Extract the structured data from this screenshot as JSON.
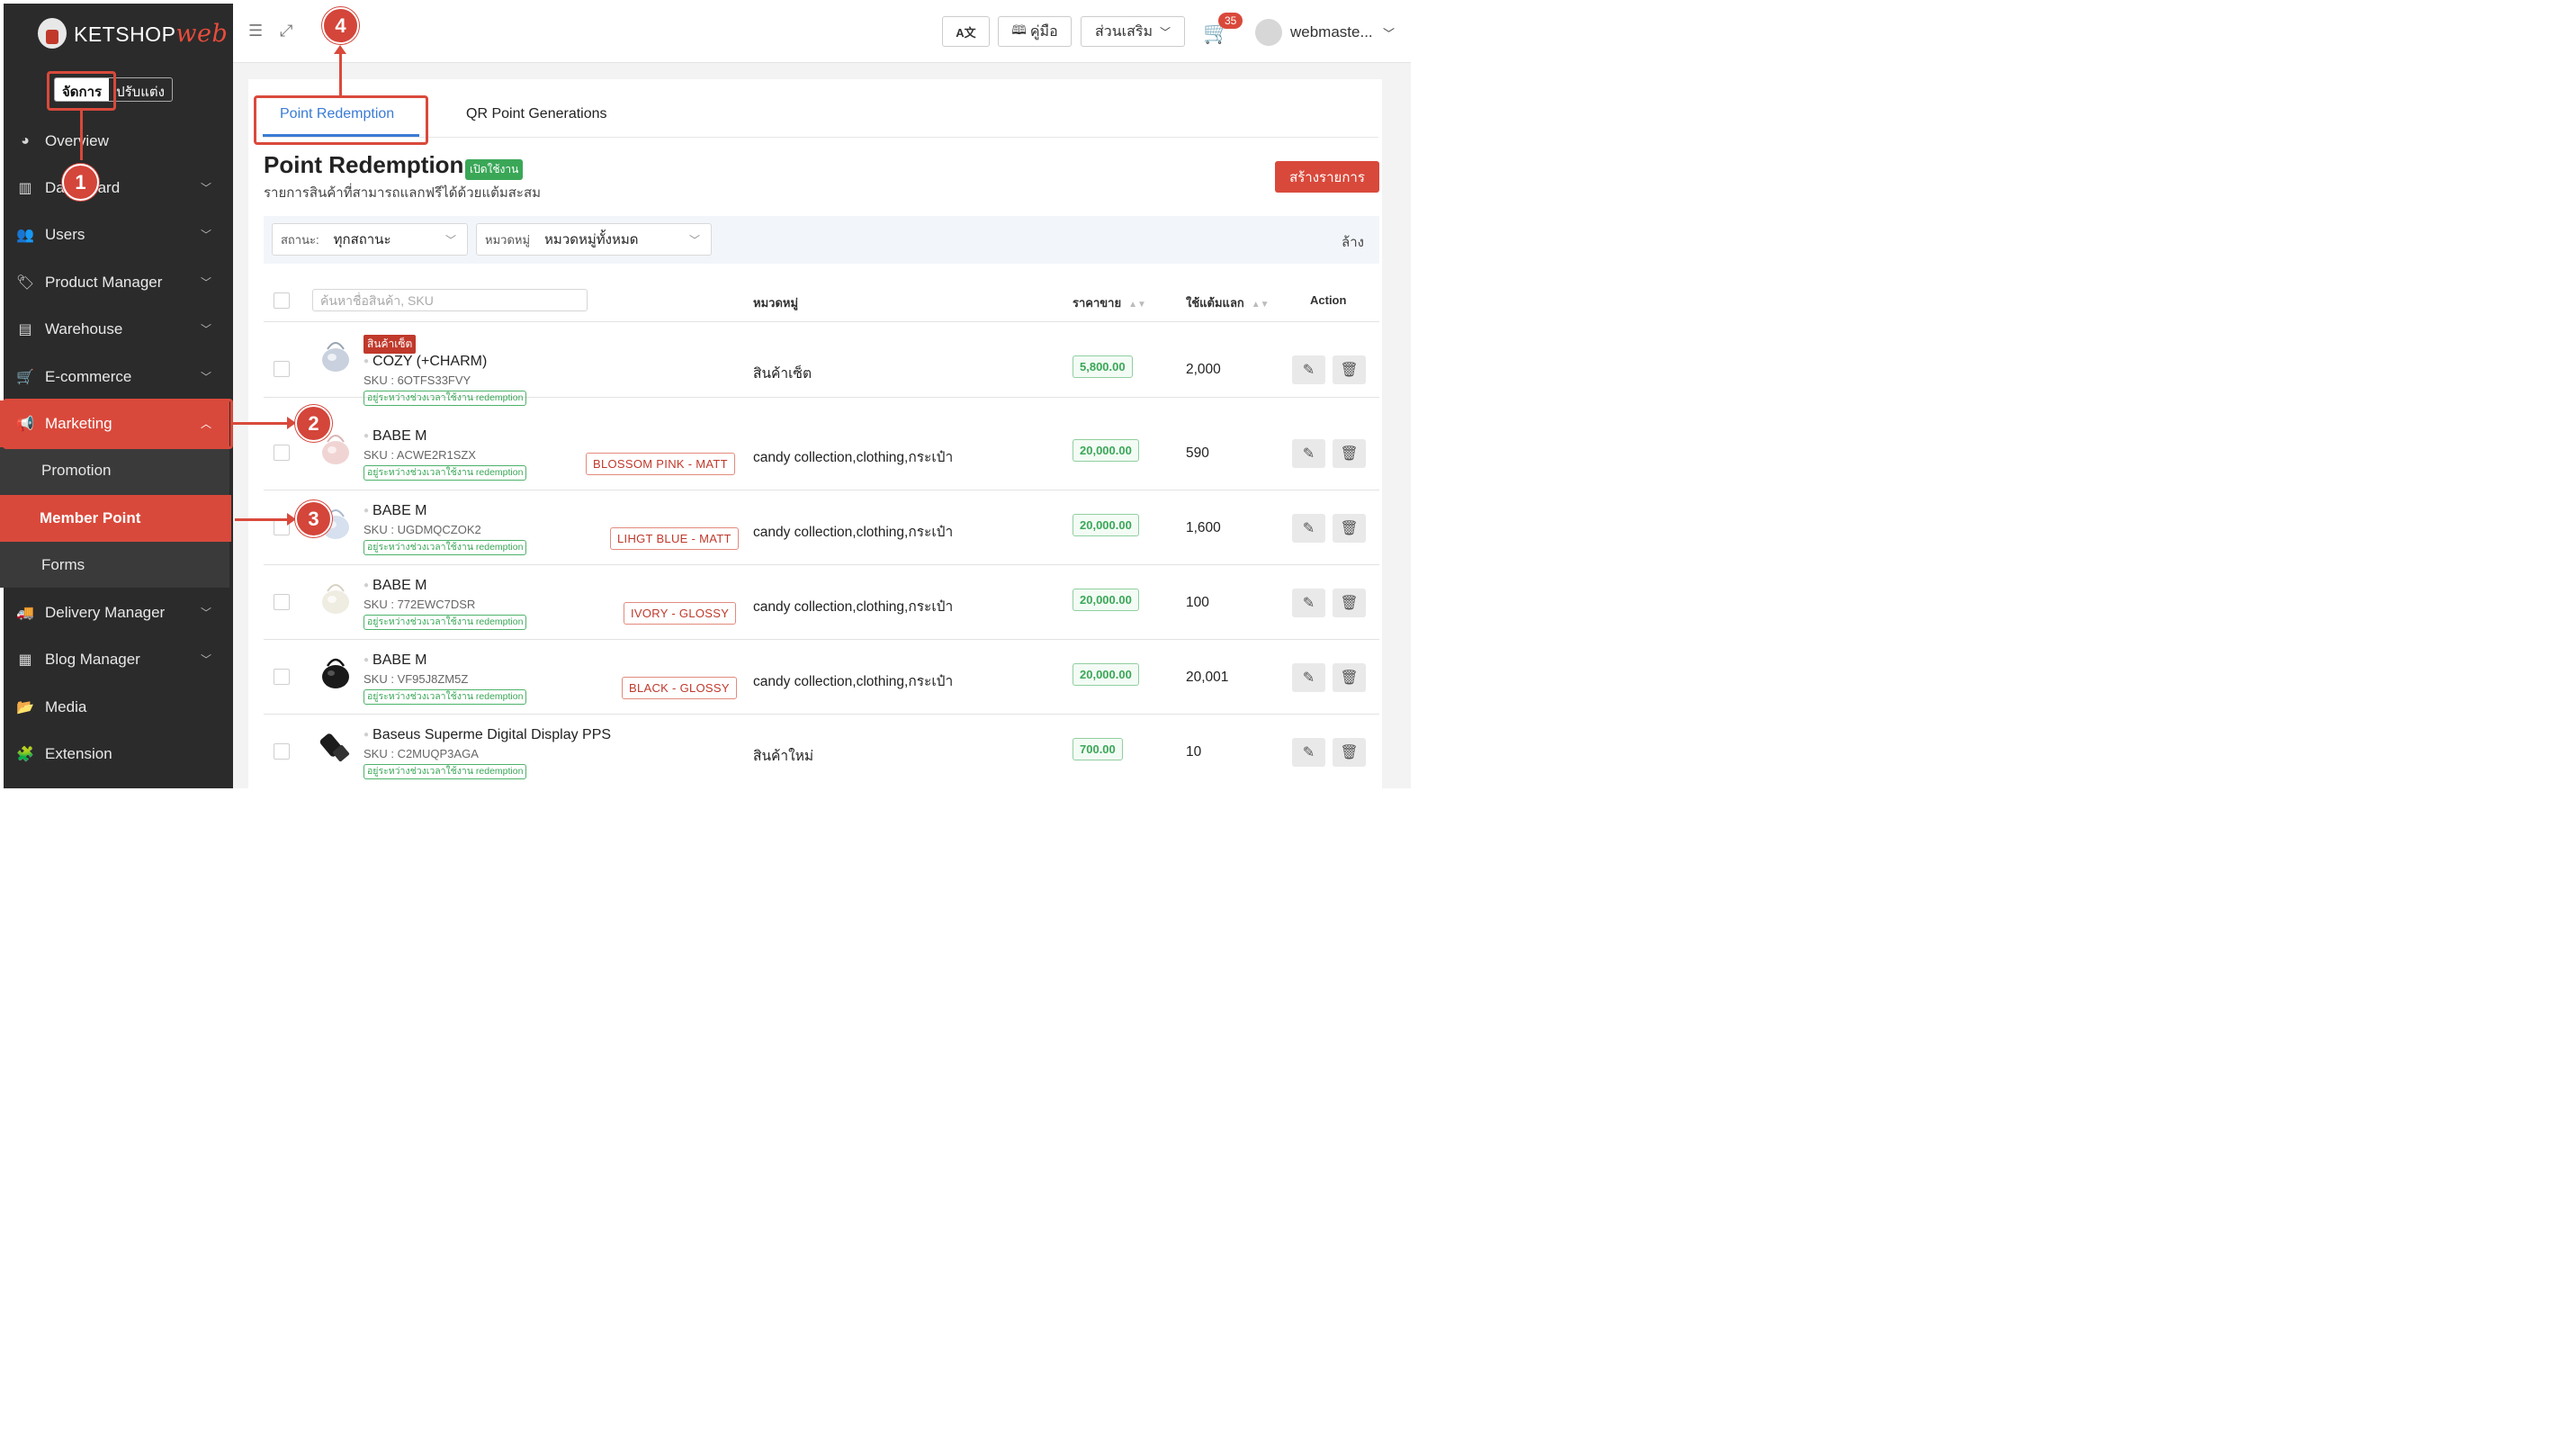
{
  "sidebar": {
    "logo": {
      "brand": "KETSHOP",
      "suffix": "web"
    },
    "mode_toggle": {
      "manage": "จัดการ",
      "customize": "ปรับแต่ง"
    },
    "items": [
      {
        "label": "Overview",
        "icon": "pie-chart-icon"
      },
      {
        "label": "Dashboard",
        "icon": "bar-chart-icon"
      },
      {
        "label": "Users",
        "icon": "users-icon"
      },
      {
        "label": "Product Manager",
        "icon": "tag-icon"
      },
      {
        "label": "Warehouse",
        "icon": "warehouse-icon"
      },
      {
        "label": "E-commerce",
        "icon": "cart-icon"
      },
      {
        "label": "Marketing",
        "icon": "megaphone-icon"
      },
      {
        "label": "Delivery Manager",
        "icon": "truck-icon"
      },
      {
        "label": "Blog Manager",
        "icon": "blog-icon"
      },
      {
        "label": "Media",
        "icon": "folder-icon"
      },
      {
        "label": "Extension",
        "icon": "puzzle-icon"
      }
    ],
    "sub_items": [
      {
        "label": "Promotion"
      },
      {
        "label": "Member Point"
      },
      {
        "label": "Forms"
      }
    ]
  },
  "topbar": {
    "lang_label": "A文",
    "manual_label": "คู่มือ",
    "addons_label": "ส่วนเสริม",
    "cart_count": "35",
    "username": "webmaste..."
  },
  "tabs": [
    "Point Redemption",
    "QR Point Generations"
  ],
  "page": {
    "title": "Point Redemption",
    "status": "เปิดใช้งาน",
    "subtitle": "รายการสินค้าที่สามารถแลกฟรีได้ด้วยแต้มสะสม",
    "create_label": "สร้างรายการ"
  },
  "filters": {
    "status_label": "สถานะ:",
    "status_value": "ทุกสถานะ",
    "category_label": "หมวดหมู่",
    "category_value": "หมวดหมู่ทั้งหมด",
    "clear_label": "ล้าง"
  },
  "table": {
    "search_placeholder": "ค้นหาชื่อสินค้า, SKU",
    "headers": {
      "category": "หมวดหมู่",
      "price": "ราคาขาย",
      "points": "ใช้แต้มแลก",
      "action": "Action"
    },
    "rows": [
      {
        "set_badge": "สินค้าเซ็ต",
        "name": "COZY (+CHARM)",
        "sku": "SKU : 6OTFS33FVY",
        "tag": "อยู่ระหว่างช่วงเวลาใช้งาน redemption",
        "variant": "",
        "category": "สินค้าเซ็ต",
        "price": "5,800.00",
        "points": "2,000"
      },
      {
        "set_badge": "",
        "name": "BABE M",
        "sku": "SKU : ACWE2R1SZX",
        "tag": "อยู่ระหว่างช่วงเวลาใช้งาน redemption",
        "variant": "BLOSSOM PINK - MATT",
        "category": "candy collection,clothing,กระเป๋า",
        "price": "20,000.00",
        "points": "590"
      },
      {
        "set_badge": "",
        "name": "BABE M",
        "sku": "SKU : UGDMQCZOK2",
        "tag": "อยู่ระหว่างช่วงเวลาใช้งาน redemption",
        "variant": "LIHGT BLUE - MATT",
        "category": "candy collection,clothing,กระเป๋า",
        "price": "20,000.00",
        "points": "1,600"
      },
      {
        "set_badge": "",
        "name": "BABE M",
        "sku": "SKU : 772EWC7DSR",
        "tag": "อยู่ระหว่างช่วงเวลาใช้งาน redemption",
        "variant": "IVORY - GLOSSY",
        "category": "candy collection,clothing,กระเป๋า",
        "price": "20,000.00",
        "points": "100"
      },
      {
        "set_badge": "",
        "name": "BABE M",
        "sku": "SKU : VF95J8ZM5Z",
        "tag": "อยู่ระหว่างช่วงเวลาใช้งาน redemption",
        "variant": "BLACK - GLOSSY",
        "category": "candy collection,clothing,กระเป๋า",
        "price": "20,000.00",
        "points": "20,001"
      },
      {
        "set_badge": "",
        "name": "Baseus Superme Digital Display PPS",
        "sku": "SKU : C2MUQP3AGA",
        "tag": "อยู่ระหว่างช่วงเวลาใช้งาน redemption",
        "variant": "",
        "category": "สินค้าใหม่",
        "price": "700.00",
        "points": "10"
      }
    ]
  },
  "annotations": [
    "1",
    "2",
    "3",
    "4"
  ],
  "colors": {
    "accent": "#d9493b",
    "sidebar": "#2b2b2b",
    "tab_active": "#3a7bd5",
    "success": "#3aa757"
  }
}
